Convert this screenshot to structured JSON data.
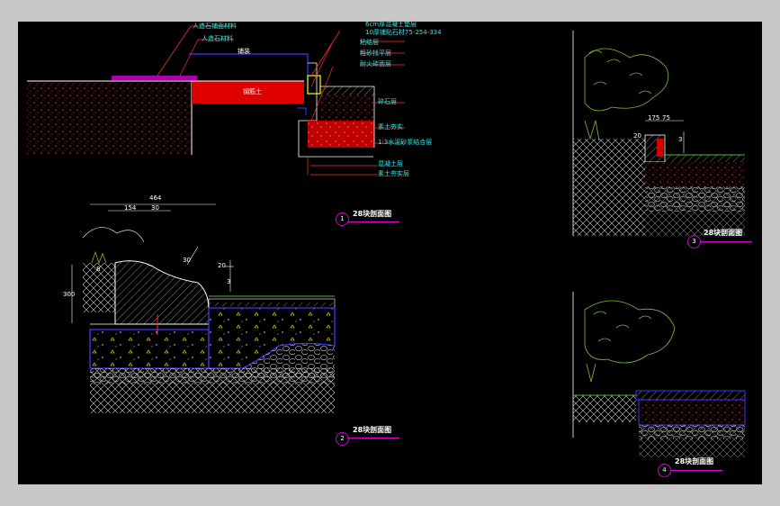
{
  "colors": {
    "background": "#000000",
    "frame": "#c8c8c8",
    "soil": "#ff2020",
    "concrete": "#ffffff",
    "leader": "#ff3030",
    "text": "#39e6e6",
    "section": "#d400d4",
    "plant": "#7fbf3f",
    "water": "#3fbf3f",
    "curb": "#3a3aff",
    "aggregate": "#ffff00"
  },
  "section1": {
    "callouts": [
      "人造石铺面材料",
      "人造石材料",
      "6cm厚混凝土垫层",
      "10厚铺贴石材75-254-334",
      "粘结层",
      "粗砂找平层",
      "耐火砖面层",
      "碎石层",
      "素土夯实",
      "1:3水泥砂浆结合层",
      "混凝土层",
      "素土夯实层"
    ],
    "mid_label": "铺装",
    "soil_label": "钢筋土",
    "title": "28块剖面图",
    "num": "1"
  },
  "section2": {
    "dims": [
      "464",
      "154",
      "30",
      "30",
      "300",
      "8",
      "20",
      "3"
    ],
    "title": "28块剖面图",
    "num": "2"
  },
  "section3": {
    "dims": [
      "175",
      "75",
      "20",
      "3"
    ],
    "title": "28块剖面图",
    "num": "3"
  },
  "section4": {
    "title": "28块剖面图",
    "num": "4"
  }
}
